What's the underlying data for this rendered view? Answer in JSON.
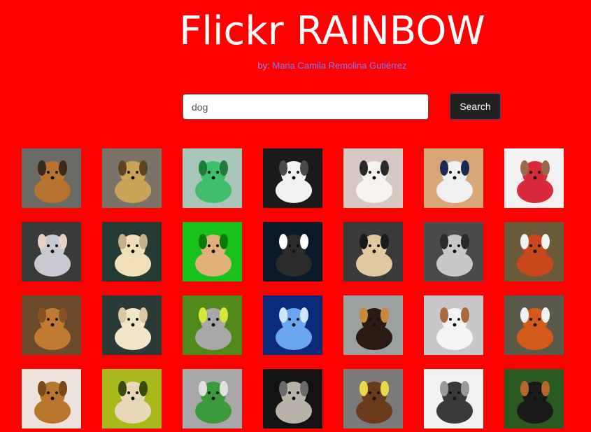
{
  "header": {
    "title": "Flickr RAINBOW",
    "byline_prefix": "by: ",
    "byline_author": "Maria Camila Remolina Gutiérrez"
  },
  "search": {
    "value": "dog",
    "button_label": "Search"
  },
  "photos": [
    {
      "bg": "#6b6b66",
      "subject": "#b8742e",
      "accent": "#3a2a1a"
    },
    {
      "bg": "#7a7468",
      "subject": "#c9a458",
      "accent": "#5c4520"
    },
    {
      "bg": "#a9c7b8",
      "subject": "#3fbf6a",
      "accent": "#1f7a3c"
    },
    {
      "bg": "#1a1a1a",
      "subject": "#f1f1f1",
      "accent": "#4a4a4a"
    },
    {
      "bg": "#d8c8c2",
      "subject": "#f6f2ee",
      "accent": "#2a2a2a"
    },
    {
      "bg": "#d9a777",
      "subject": "#f0f0f0",
      "accent": "#1b2a55"
    },
    {
      "bg": "#f2f2f2",
      "subject": "#d82a3a",
      "accent": "#9a6a4a"
    },
    {
      "bg": "#3a3a3a",
      "subject": "#c9c9d1",
      "accent": "#e7d2c6"
    },
    {
      "bg": "#233b33",
      "subject": "#f0dfb8",
      "accent": "#c8b08a"
    },
    {
      "bg": "#19c21a",
      "subject": "#e1b07a",
      "accent": "#0b7a0b"
    },
    {
      "bg": "#0b1a2a",
      "subject": "#2b2b2b",
      "accent": "#ffffff"
    },
    {
      "bg": "#3a3a3a",
      "subject": "#e0c8a0",
      "accent": "#1a1a1a"
    },
    {
      "bg": "#4a4a4a",
      "subject": "#c8c8c8",
      "accent": "#2a2a2a"
    },
    {
      "bg": "#6a5a3a",
      "subject": "#c8481a",
      "accent": "#f2f2f2"
    },
    {
      "bg": "#6a4a2a",
      "subject": "#c07a32",
      "accent": "#8a5222"
    },
    {
      "bg": "#2a3a36",
      "subject": "#f2e6c8",
      "accent": "#d9c8a0"
    },
    {
      "bg": "#4f8a1a",
      "subject": "#a8a8a8",
      "accent": "#d7e63a"
    },
    {
      "bg": "#0c2a7a",
      "subject": "#6aa6f2",
      "accent": "#cfe6ff"
    },
    {
      "bg": "#9aa2a0",
      "subject": "#2a1a12",
      "accent": "#c88a3a"
    },
    {
      "bg": "#c8c8c8",
      "subject": "#f4f4f4",
      "accent": "#a86a3a"
    },
    {
      "bg": "#5a5a4a",
      "subject": "#d45a1a",
      "accent": "#f2f2f2"
    },
    {
      "bg": "#ece4da",
      "subject": "#b9772e",
      "accent": "#7a4a1a"
    },
    {
      "bg": "#a9b81a",
      "subject": "#e8d8b8",
      "accent": "#3a4a0a"
    },
    {
      "bg": "#a8a8a8",
      "subject": "#3c9a3c",
      "accent": "#e0e0e0"
    },
    {
      "bg": "#121212",
      "subject": "#b8b2a8",
      "accent": "#6a6a6a"
    },
    {
      "bg": "#7a7a7a",
      "subject": "#6a3a1a",
      "accent": "#e8d84a"
    },
    {
      "bg": "#f2f2f2",
      "subject": "#3a3a3a",
      "accent": "#9a9a9a"
    },
    {
      "bg": "#2a5a22",
      "subject": "#1a1a1a",
      "accent": "#b8682a"
    }
  ]
}
